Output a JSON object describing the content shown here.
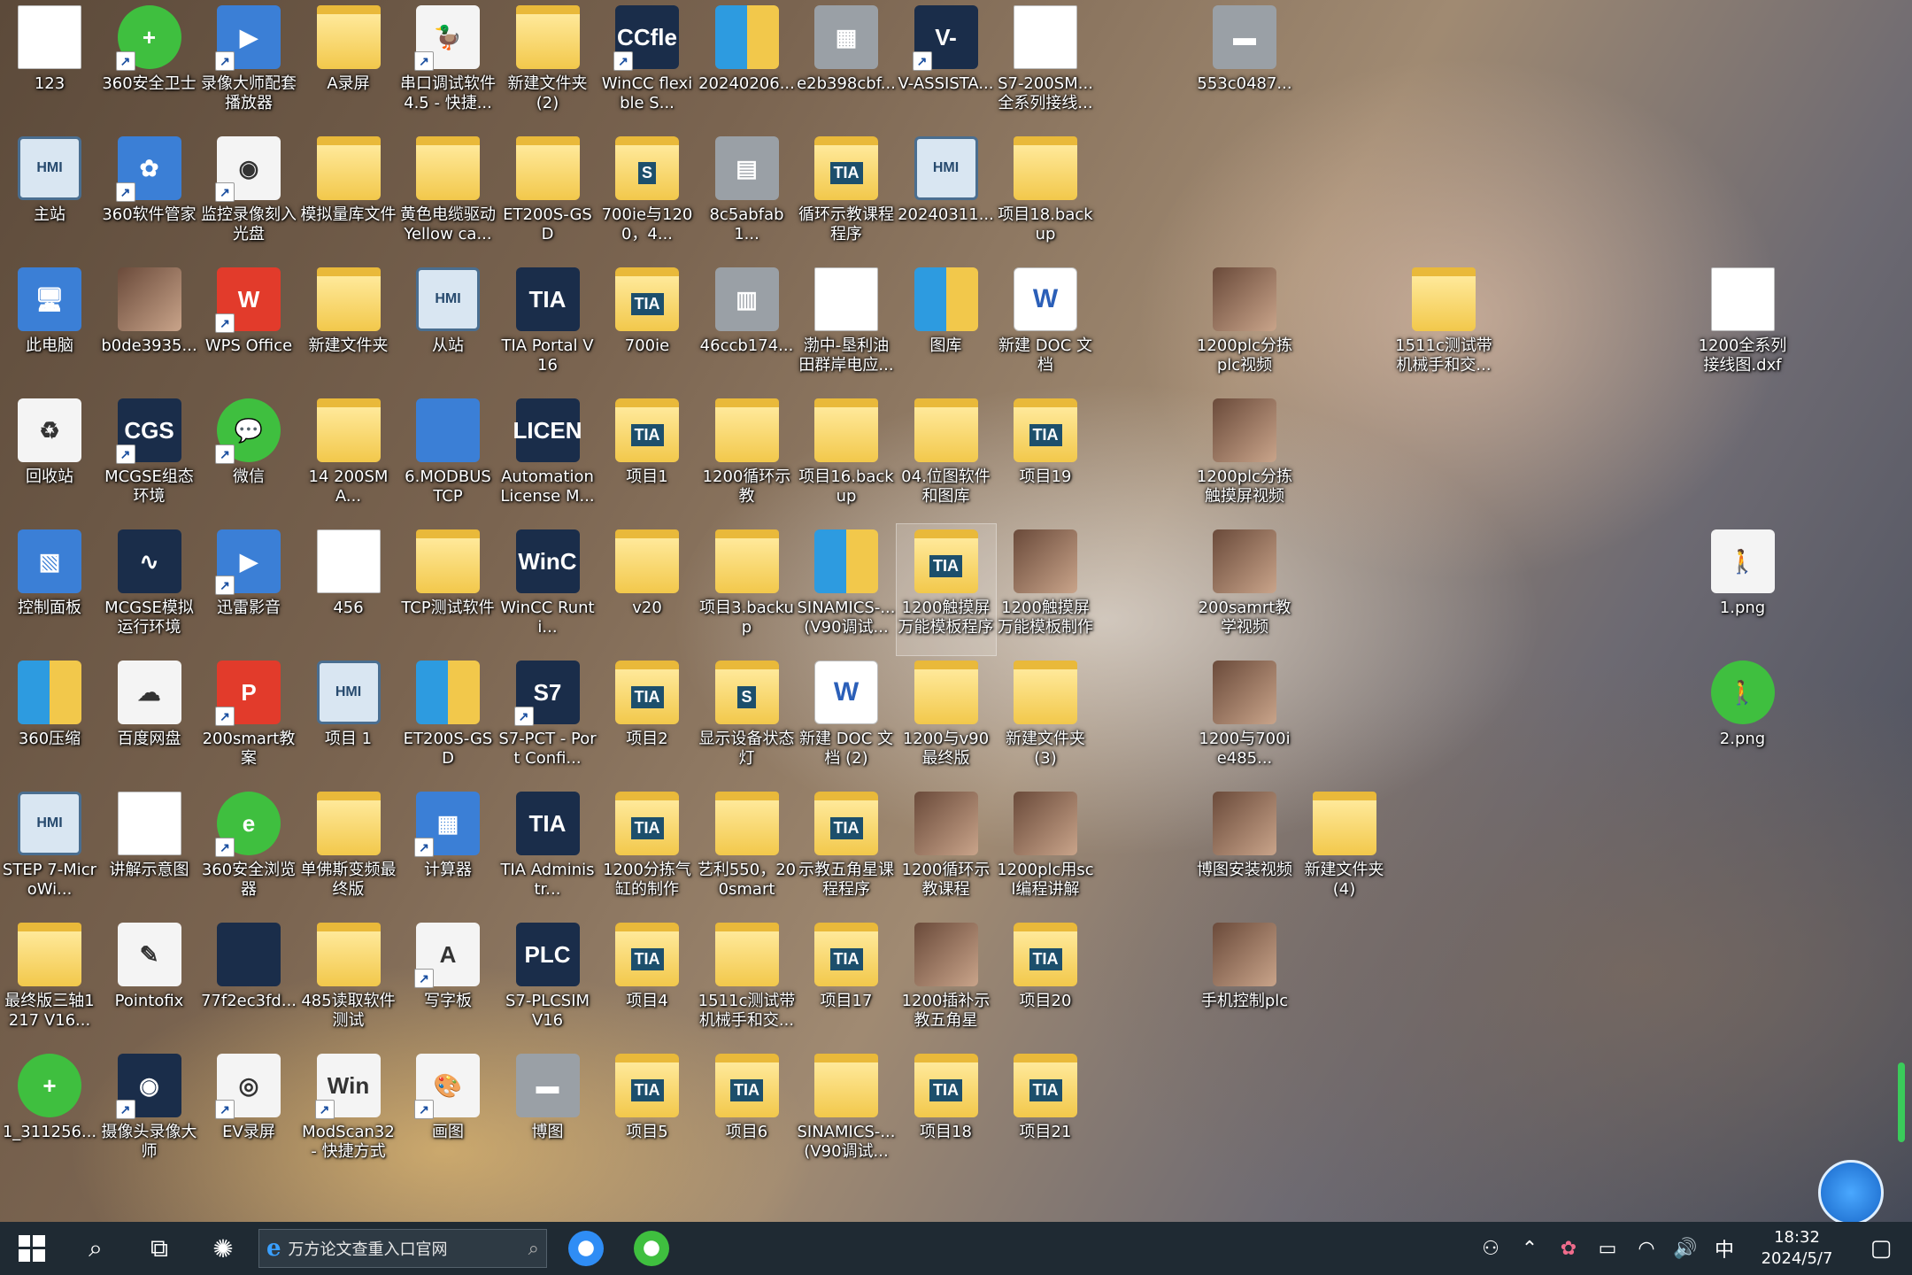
{
  "icons": [
    {
      "name": "icon-123",
      "label": "123",
      "glyph": "doc",
      "glyphText": "",
      "col": 0,
      "row": 0
    },
    {
      "name": "icon-360-safe",
      "label": "360安全卫士",
      "glyph": "green",
      "glyphText": "+",
      "col": 1,
      "row": 0,
      "shortcut": true
    },
    {
      "name": "icon-recorder-player",
      "label": "录像大师配套播放器",
      "glyph": "blue",
      "glyphText": "▶",
      "col": 2,
      "row": 0,
      "shortcut": true
    },
    {
      "name": "icon-a-recording",
      "label": "A录屏",
      "glyph": "folder",
      "glyphText": "",
      "col": 3,
      "row": 0
    },
    {
      "name": "icon-serial-debug",
      "label": "串口调试软件4.5 - 快捷...",
      "glyph": "white",
      "glyphText": "🦆",
      "col": 4,
      "row": 0,
      "shortcut": true
    },
    {
      "name": "icon-new-folder-2",
      "label": "新建文件夹(2)",
      "glyph": "folder",
      "glyphText": "",
      "col": 5,
      "row": 0
    },
    {
      "name": "icon-wincc-flexible",
      "label": "WinCC flexible S...",
      "glyph": "dark",
      "glyphText": "CCfle",
      "col": 6,
      "row": 0,
      "shortcut": true
    },
    {
      "name": "icon-20240206",
      "label": "20240206...",
      "glyph": "zip",
      "glyphText": "",
      "col": 7,
      "row": 0
    },
    {
      "name": "icon-e2b398cbf",
      "label": "e2b398cbf...",
      "glyph": "gray",
      "glyphText": "▦",
      "col": 8,
      "row": 0
    },
    {
      "name": "icon-v-assist",
      "label": "V-ASSISTA...",
      "glyph": "dark",
      "glyphText": "V-",
      "col": 9,
      "row": 0,
      "shortcut": true
    },
    {
      "name": "icon-s7-200smart",
      "label": "S7-200SM...全系列接线...",
      "glyph": "doc",
      "glyphText": "",
      "col": 10,
      "row": 0
    },
    {
      "name": "icon-553c0487",
      "label": "553c0487...",
      "glyph": "gray",
      "glyphText": "▬",
      "col": 12,
      "row": 0
    },
    {
      "name": "icon-master",
      "label": "主站",
      "glyph": "hmi",
      "glyphText": "HMI",
      "col": 0,
      "row": 1
    },
    {
      "name": "icon-360-manager",
      "label": "360软件管家",
      "glyph": "blue",
      "glyphText": "✿",
      "col": 1,
      "row": 1,
      "shortcut": true
    },
    {
      "name": "icon-monitor-burn",
      "label": "监控录像刻入光盘",
      "glyph": "white",
      "glyphText": "◉",
      "col": 2,
      "row": 1,
      "shortcut": true
    },
    {
      "name": "icon-simulate-files",
      "label": "模拟量库文件",
      "glyph": "folder",
      "glyphText": "",
      "col": 3,
      "row": 1
    },
    {
      "name": "icon-yellow-cable",
      "label": "黄色电缆驱动Yellow ca...",
      "glyph": "folder",
      "glyphText": "",
      "col": 4,
      "row": 1
    },
    {
      "name": "icon-et200s-gsd",
      "label": "ET200S-GSD",
      "glyph": "folder",
      "glyphText": "",
      "col": 5,
      "row": 1
    },
    {
      "name": "icon-700ie-1200",
      "label": "700ie与1200，4...",
      "glyph": "tia",
      "glyphText": "S",
      "col": 6,
      "row": 1
    },
    {
      "name": "icon-8c5abfab1",
      "label": "8c5abfab1...",
      "glyph": "gray",
      "glyphText": "▤",
      "col": 7,
      "row": 1
    },
    {
      "name": "icon-loop-demo",
      "label": "循环示教课程程序",
      "glyph": "tia",
      "glyphText": "TIA",
      "col": 8,
      "row": 1
    },
    {
      "name": "icon-20240311",
      "label": "20240311...",
      "glyph": "hmi",
      "glyphText": "HMI",
      "col": 9,
      "row": 1
    },
    {
      "name": "icon-project18-backup",
      "label": "项目18.backup",
      "glyph": "folder",
      "glyphText": "",
      "col": 10,
      "row": 1
    },
    {
      "name": "icon-this-pc",
      "label": "此电脑",
      "glyph": "blue",
      "glyphText": "🖥",
      "col": 0,
      "row": 2
    },
    {
      "name": "icon-b0de3935",
      "label": "b0de3935...",
      "glyph": "photo",
      "glyphText": "",
      "col": 1,
      "row": 2
    },
    {
      "name": "icon-wps-office",
      "label": "WPS Office",
      "glyph": "red",
      "glyphText": "W",
      "col": 2,
      "row": 2,
      "shortcut": true
    },
    {
      "name": "icon-new-folder",
      "label": "新建文件夹",
      "glyph": "folder",
      "glyphText": "",
      "col": 3,
      "row": 2
    },
    {
      "name": "icon-slave",
      "label": "从站",
      "glyph": "hmi",
      "glyphText": "HMI",
      "col": 4,
      "row": 2
    },
    {
      "name": "icon-tia-portal-v16",
      "label": "TIA Portal V16",
      "glyph": "dark",
      "glyphText": "TIA",
      "col": 5,
      "row": 2
    },
    {
      "name": "icon-700ie",
      "label": "700ie",
      "glyph": "tia",
      "glyphText": "TIA",
      "col": 6,
      "row": 2
    },
    {
      "name": "icon-46ccb174",
      "label": "46ccb174...",
      "glyph": "gray",
      "glyphText": "▥",
      "col": 7,
      "row": 2
    },
    {
      "name": "icon-bohai-oil",
      "label": "渤中-垦利油田群岸电应...",
      "glyph": "doc",
      "glyphText": "",
      "col": 8,
      "row": 2
    },
    {
      "name": "icon-gallery",
      "label": "图库",
      "glyph": "zip",
      "glyphText": "",
      "col": 9,
      "row": 2
    },
    {
      "name": "icon-new-doc",
      "label": "新建 DOC 文档",
      "glyph": "word",
      "glyphText": "W",
      "col": 10,
      "row": 2
    },
    {
      "name": "icon-1200plc-sort-video",
      "label": "1200plc分拣plc视频",
      "glyph": "photo",
      "glyphText": "",
      "col": 12,
      "row": 2
    },
    {
      "name": "icon-1511c-test",
      "label": "1511c测试带机械手和交...",
      "glyph": "folder",
      "glyphText": "",
      "col": 14,
      "row": 2
    },
    {
      "name": "icon-1200-wiring-dxf",
      "label": "1200全系列接线图.dxf",
      "glyph": "doc",
      "glyphText": "",
      "col": 17,
      "row": 2
    },
    {
      "name": "icon-recycle-bin",
      "label": "回收站",
      "glyph": "white",
      "glyphText": "♻",
      "col": 0,
      "row": 3
    },
    {
      "name": "icon-mcgse-env",
      "label": "MCGSE组态环境",
      "glyph": "dark",
      "glyphText": "CGS",
      "col": 1,
      "row": 3,
      "shortcut": true
    },
    {
      "name": "icon-wechat",
      "label": "微信",
      "glyph": "green",
      "glyphText": "💬",
      "col": 2,
      "row": 3,
      "shortcut": true
    },
    {
      "name": "icon-14-200sma",
      "label": "14 200SMA...",
      "glyph": "folder",
      "glyphText": "",
      "col": 3,
      "row": 3
    },
    {
      "name": "icon-modbus-tcp",
      "label": "6.MODBUS TCP",
      "glyph": "blue",
      "glyphText": "",
      "col": 4,
      "row": 3
    },
    {
      "name": "icon-automation-license",
      "label": "Automation License M...",
      "glyph": "dark",
      "glyphText": "LICEN",
      "col": 5,
      "row": 3
    },
    {
      "name": "icon-project1",
      "label": "项目1",
      "glyph": "tia",
      "glyphText": "TIA",
      "col": 6,
      "row": 3
    },
    {
      "name": "icon-1200-loop-demo",
      "label": "1200循环示教",
      "glyph": "folder",
      "glyphText": "",
      "col": 7,
      "row": 3
    },
    {
      "name": "icon-project16-backup",
      "label": "项目16.backup",
      "glyph": "folder",
      "glyphText": "",
      "col": 8,
      "row": 3
    },
    {
      "name": "icon-04-bitmap",
      "label": "04.位图软件和图库",
      "glyph": "folder",
      "glyphText": "",
      "col": 9,
      "row": 3
    },
    {
      "name": "icon-project19",
      "label": "项目19",
      "glyph": "tia",
      "glyphText": "TIA",
      "col": 10,
      "row": 3
    },
    {
      "name": "icon-1200plc-touch-video",
      "label": "1200plc分拣触摸屏视频",
      "glyph": "photo",
      "glyphText": "",
      "col": 12,
      "row": 3
    },
    {
      "name": "icon-control-panel",
      "label": "控制面板",
      "glyph": "blue",
      "glyphText": "▧",
      "col": 0,
      "row": 4
    },
    {
      "name": "icon-mcgse-sim",
      "label": "MCGSE模拟运行环境",
      "glyph": "dark",
      "glyphText": "∿",
      "col": 1,
      "row": 4
    },
    {
      "name": "icon-xunlei",
      "label": "迅雷影音",
      "glyph": "blue",
      "glyphText": "▶",
      "col": 2,
      "row": 4,
      "shortcut": true
    },
    {
      "name": "icon-456",
      "label": "456",
      "glyph": "doc",
      "glyphText": "",
      "col": 3,
      "row": 4
    },
    {
      "name": "icon-tcp-test",
      "label": "TCP测试软件",
      "glyph": "folder",
      "glyphText": "",
      "col": 4,
      "row": 4
    },
    {
      "name": "icon-wincc-runtime",
      "label": "WinCC Runti...",
      "glyph": "dark",
      "glyphText": "WinC",
      "col": 5,
      "row": 4
    },
    {
      "name": "icon-v20",
      "label": "v20",
      "glyph": "folder",
      "glyphText": "",
      "col": 6,
      "row": 4
    },
    {
      "name": "icon-project3-backup",
      "label": "项目3.backup",
      "glyph": "folder",
      "glyphText": "",
      "col": 7,
      "row": 4
    },
    {
      "name": "icon-sinamics-v90",
      "label": "SINAMICS-...(V90调试...",
      "glyph": "zip",
      "glyphText": "",
      "col": 8,
      "row": 4
    },
    {
      "name": "icon-1200-touch-template",
      "label": "1200触摸屏万能模板程序",
      "glyph": "tia",
      "glyphText": "TIA",
      "col": 9,
      "row": 4,
      "selected": true
    },
    {
      "name": "icon-1200-touch-template-make",
      "label": "1200触摸屏万能模板制作",
      "glyph": "photo",
      "glyphText": "",
      "col": 10,
      "row": 4
    },
    {
      "name": "icon-200samrt-video",
      "label": "200samrt教学视频",
      "glyph": "photo",
      "glyphText": "",
      "col": 12,
      "row": 4
    },
    {
      "name": "icon-1png",
      "label": "1.png",
      "glyph": "white",
      "glyphText": "🚶",
      "col": 17,
      "row": 4
    },
    {
      "name": "icon-360-zip",
      "label": "360压缩",
      "glyph": "zip",
      "glyphText": "",
      "col": 0,
      "row": 5
    },
    {
      "name": "icon-baidu-pan",
      "label": "百度网盘",
      "glyph": "white",
      "glyphText": "☁",
      "col": 1,
      "row": 5
    },
    {
      "name": "icon-200smart-case",
      "label": "200smart教案",
      "glyph": "red",
      "glyphText": "P",
      "col": 2,
      "row": 5,
      "shortcut": true
    },
    {
      "name": "icon-project-1",
      "label": "项目 1",
      "glyph": "hmi",
      "glyphText": "HMI",
      "col": 3,
      "row": 5
    },
    {
      "name": "icon-et200s-gsd-zip",
      "label": "ET200S-GSD",
      "glyph": "zip",
      "glyphText": "",
      "col": 4,
      "row": 5
    },
    {
      "name": "icon-s7-pct",
      "label": "S7-PCT - Port Confi...",
      "glyph": "dark",
      "glyphText": "S7",
      "col": 5,
      "row": 5,
      "shortcut": true
    },
    {
      "name": "icon-project2",
      "label": "项目2",
      "glyph": "tia",
      "glyphText": "TIA",
      "col": 6,
      "row": 5
    },
    {
      "name": "icon-display-status-light",
      "label": "显示设备状态灯",
      "glyph": "tia",
      "glyphText": "S",
      "col": 7,
      "row": 5
    },
    {
      "name": "icon-new-doc-2",
      "label": "新建 DOC 文档 (2)",
      "glyph": "word",
      "glyphText": "W",
      "col": 8,
      "row": 5
    },
    {
      "name": "icon-1200-v90-final",
      "label": "1200与v90最终版",
      "glyph": "folder",
      "glyphText": "",
      "col": 9,
      "row": 5
    },
    {
      "name": "icon-new-folder-3",
      "label": "新建文件夹(3)",
      "glyph": "folder",
      "glyphText": "",
      "col": 10,
      "row": 5
    },
    {
      "name": "icon-1200-700ie485",
      "label": "1200与700ie485...",
      "glyph": "photo",
      "glyphText": "",
      "col": 12,
      "row": 5
    },
    {
      "name": "icon-2png",
      "label": "2.png",
      "glyph": "green",
      "glyphText": "🚶",
      "col": 17,
      "row": 5
    },
    {
      "name": "icon-step7-microwin",
      "label": "STEP 7-MicroWi...",
      "glyph": "hmi",
      "glyphText": "HMI",
      "col": 0,
      "row": 6
    },
    {
      "name": "icon-lecture-diagram",
      "label": "讲解示意图",
      "glyph": "doc",
      "glyphText": "",
      "col": 1,
      "row": 6
    },
    {
      "name": "icon-360-browser",
      "label": "360安全浏览器",
      "glyph": "green",
      "glyphText": "e",
      "col": 2,
      "row": 6,
      "shortcut": true
    },
    {
      "name": "icon-danfoss-vfd",
      "label": "单佛斯变频最终版",
      "glyph": "folder",
      "glyphText": "",
      "col": 3,
      "row": 6
    },
    {
      "name": "icon-calculator",
      "label": "计算器",
      "glyph": "blue",
      "glyphText": "▦",
      "col": 4,
      "row": 6,
      "shortcut": true
    },
    {
      "name": "icon-tia-administrator",
      "label": "TIA Administr...",
      "glyph": "dark",
      "glyphText": "TIA",
      "col": 5,
      "row": 6
    },
    {
      "name": "icon-1200-sort-cylinder",
      "label": "1200分拣气缸的制作",
      "glyph": "tia",
      "glyphText": "TIA",
      "col": 6,
      "row": 6
    },
    {
      "name": "icon-yili550",
      "label": "艺利550，200smart",
      "glyph": "folder",
      "glyphText": "",
      "col": 7,
      "row": 6
    },
    {
      "name": "icon-teach-pentagram",
      "label": "示教五角星课程程序",
      "glyph": "tia",
      "glyphText": "TIA",
      "col": 8,
      "row": 6
    },
    {
      "name": "icon-1200-loop-course",
      "label": "1200循环示教课程",
      "glyph": "photo",
      "glyphText": "",
      "col": 9,
      "row": 6
    },
    {
      "name": "icon-1200plc-scl",
      "label": "1200plc用scl编程讲解",
      "glyph": "photo",
      "glyphText": "",
      "col": 10,
      "row": 6
    },
    {
      "name": "icon-botu-install-video",
      "label": "博图安装视频",
      "glyph": "photo",
      "glyphText": "",
      "col": 12,
      "row": 6
    },
    {
      "name": "icon-new-folder-4",
      "label": "新建文件夹(4)",
      "glyph": "folder",
      "glyphText": "",
      "col": 13,
      "row": 6
    },
    {
      "name": "icon-final-3axis",
      "label": "最终版三轴1217 V16...",
      "glyph": "folder",
      "glyphText": "",
      "col": 0,
      "row": 7
    },
    {
      "name": "icon-pointofix",
      "label": "Pointofix",
      "glyph": "white",
      "glyphText": "✎",
      "col": 1,
      "row": 7
    },
    {
      "name": "icon-77f2ec3fd",
      "label": "77f2ec3fd...",
      "glyph": "dark",
      "glyphText": "",
      "col": 2,
      "row": 7
    },
    {
      "name": "icon-485-read-test",
      "label": "485读取软件测试",
      "glyph": "folder",
      "glyphText": "",
      "col": 3,
      "row": 7
    },
    {
      "name": "icon-wordpad",
      "label": "写字板",
      "glyph": "white",
      "glyphText": "A",
      "col": 4,
      "row": 7,
      "shortcut": true
    },
    {
      "name": "icon-s7-plcsim",
      "label": "S7-PLCSIM V16",
      "glyph": "dark",
      "glyphText": "PLC",
      "col": 5,
      "row": 7
    },
    {
      "name": "icon-project4",
      "label": "项目4",
      "glyph": "tia",
      "glyphText": "TIA",
      "col": 6,
      "row": 7
    },
    {
      "name": "icon-1511c-test-2",
      "label": "1511c测试带机械手和交...",
      "glyph": "folder",
      "glyphText": "",
      "col": 7,
      "row": 7
    },
    {
      "name": "icon-project17",
      "label": "项目17",
      "glyph": "tia",
      "glyphText": "TIA",
      "col": 8,
      "row": 7
    },
    {
      "name": "icon-1200-interp-pentagram",
      "label": "1200插补示教五角星",
      "glyph": "photo",
      "glyphText": "",
      "col": 9,
      "row": 7
    },
    {
      "name": "icon-project20",
      "label": "项目20",
      "glyph": "tia",
      "glyphText": "TIA",
      "col": 10,
      "row": 7
    },
    {
      "name": "icon-phone-control-plc",
      "label": "手机控制plc",
      "glyph": "photo",
      "glyphText": "",
      "col": 12,
      "row": 7
    },
    {
      "name": "icon-1-311256",
      "label": "1_311256...",
      "glyph": "green",
      "glyphText": "+",
      "col": 0,
      "row": 8
    },
    {
      "name": "icon-camera-master",
      "label": "摄像头录像大师",
      "glyph": "dark",
      "glyphText": "◉",
      "col": 1,
      "row": 8,
      "shortcut": true
    },
    {
      "name": "icon-ev-recorder",
      "label": "EV录屏",
      "glyph": "white",
      "glyphText": "◎",
      "col": 2,
      "row": 8,
      "shortcut": true
    },
    {
      "name": "icon-modscan32",
      "label": "ModScan32 - 快捷方式",
      "glyph": "white",
      "glyphText": "Win",
      "col": 3,
      "row": 8,
      "shortcut": true
    },
    {
      "name": "icon-paint",
      "label": "画图",
      "glyph": "white",
      "glyphText": "🎨",
      "col": 4,
      "row": 8,
      "shortcut": true
    },
    {
      "name": "icon-botu",
      "label": "博图",
      "glyph": "gray",
      "glyphText": "▬",
      "col": 5,
      "row": 8
    },
    {
      "name": "icon-project5",
      "label": "项目5",
      "glyph": "tia",
      "glyphText": "TIA",
      "col": 6,
      "row": 8
    },
    {
      "name": "icon-project6",
      "label": "项目6",
      "glyph": "tia",
      "glyphText": "TIA",
      "col": 7,
      "row": 8
    },
    {
      "name": "icon-sinamics-v90-2",
      "label": "SINAMICS-...(V90调试...",
      "glyph": "folder",
      "glyphText": "",
      "col": 8,
      "row": 8
    },
    {
      "name": "icon-project18",
      "label": "项目18",
      "glyph": "tia",
      "glyphText": "TIA",
      "col": 9,
      "row": 8
    },
    {
      "name": "icon-project21",
      "label": "项目21",
      "glyph": "tia",
      "glyphText": "TIA",
      "col": 10,
      "row": 8
    }
  ],
  "taskbar": {
    "search_text": "万方论文查重入口官网",
    "tray_input_method": "中",
    "clock_time": "18:32",
    "clock_date": "2024/5/7"
  },
  "colors": {
    "taskbar_bg": "#1f2a33",
    "accent_blue": "#1766c8"
  }
}
